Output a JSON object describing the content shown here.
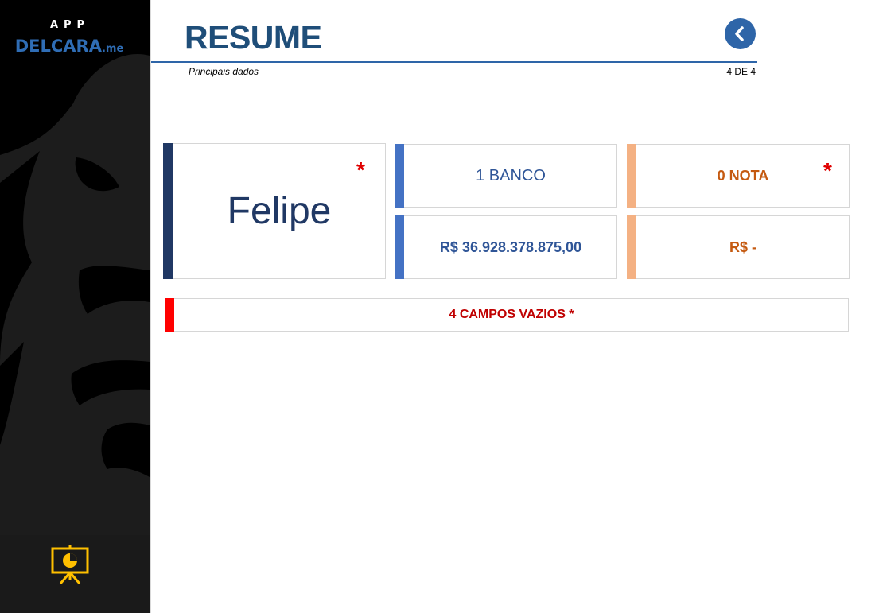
{
  "sidebar": {
    "logo_top": "APP",
    "logo_name": "DELCARA",
    "logo_suffix": ".me",
    "footer_icon": "presentation-chart-icon"
  },
  "header": {
    "title": "RESUME",
    "subtitle": "Principais dados",
    "page_indicator": "4 DE 4",
    "back_icon": "chevron-left-icon"
  },
  "cards": {
    "name": {
      "value": "Felipe",
      "required_mark": "*"
    },
    "bank_count": {
      "value": "1 BANCO"
    },
    "bank_total": {
      "value": "R$ 36.928.378.875,00"
    },
    "nota_count": {
      "value": "0 NOTA",
      "required_mark": "*"
    },
    "nota_total": {
      "value": "R$ -"
    }
  },
  "warning": {
    "text": "4 CAMPOS VAZIOS *"
  },
  "colors": {
    "title": "#1f4e79",
    "bank_accent": "#4472c4",
    "nota_accent": "#f4b183",
    "name_accent": "#203864",
    "warning_accent": "#ff0000",
    "required": "#e00000"
  }
}
